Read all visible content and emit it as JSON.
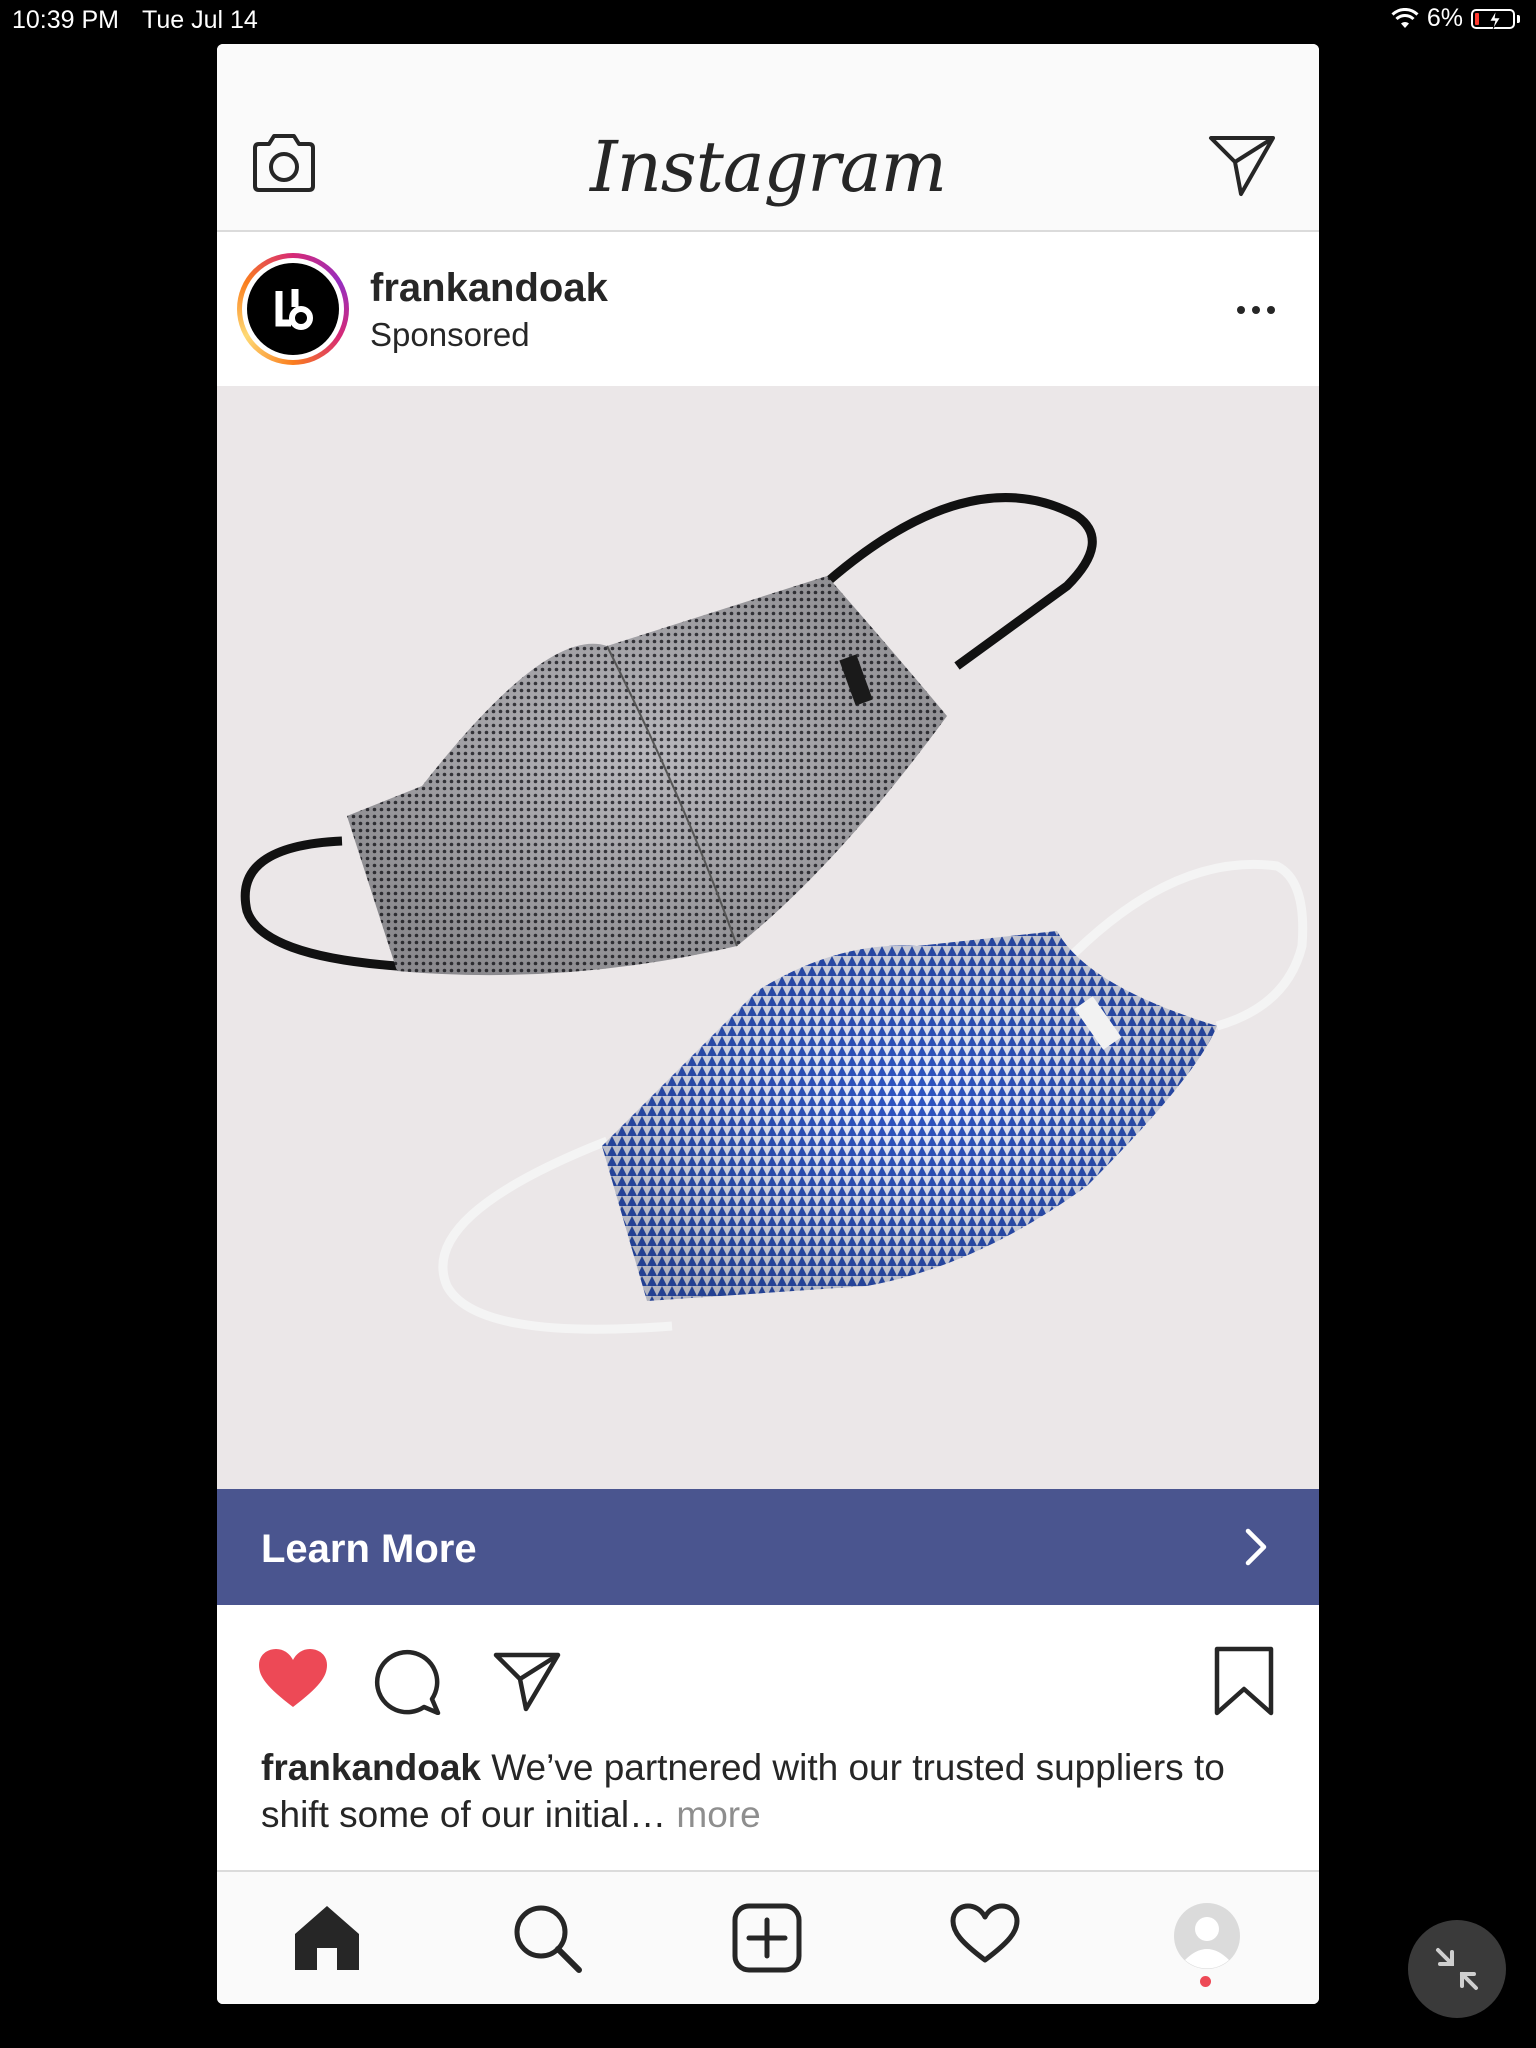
{
  "status_bar": {
    "time": "10:39 PM",
    "date": "Tue Jul 14",
    "battery": "6%",
    "wifi_icon": "wifi-icon",
    "battery_icon": "battery-charging-icon"
  },
  "header": {
    "logo": "Instagram",
    "left_icon": "camera-icon",
    "right_icon": "direct-message-icon"
  },
  "post": {
    "username": "frankandoak",
    "subtitle": "Sponsored",
    "options_icon": "more-options-icon",
    "image_description": "two fabric face masks",
    "cta_label": "Learn More",
    "cta_icon": "chevron-right-icon",
    "liked": true,
    "caption_user": "frankandoak",
    "caption_text": " We’ve partnered with our trusted suppliers to shift some of our initial… ",
    "caption_more": "more"
  },
  "colors": {
    "cta_background": "#4a558f",
    "like_red": "#ed4956",
    "text": "#262626",
    "muted": "#8e8e8e"
  },
  "tab_bar": {
    "items": [
      "home-icon",
      "search-icon",
      "new-post-icon",
      "activity-heart-icon",
      "profile-icon"
    ],
    "active": "home"
  }
}
